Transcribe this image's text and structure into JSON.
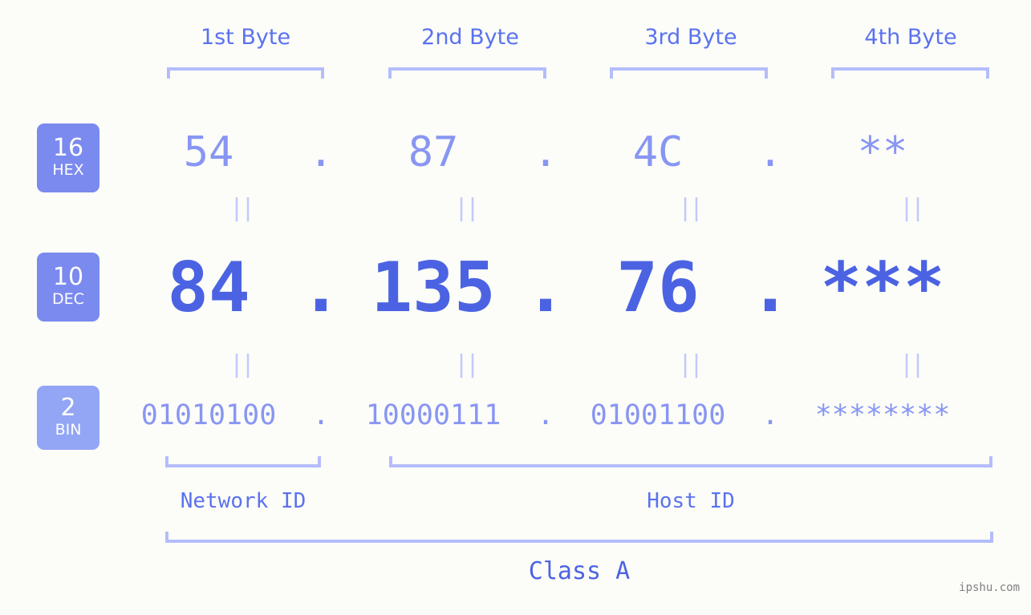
{
  "meta": {
    "background_color": "#fcfdf9",
    "accent_color": "#4b63e2",
    "accent_light_color": "#8896f2",
    "bracket_color": "#b4bdfb",
    "badge_color": "#7b8aef",
    "badge_bin_color": "#93a5f5",
    "watermark": "ipshu.com"
  },
  "byte_headers": [
    {
      "label": "1st Byte"
    },
    {
      "label": "2nd Byte"
    },
    {
      "label": "3rd Byte"
    },
    {
      "label": "4th Byte"
    }
  ],
  "radix_badges": [
    {
      "base": "16",
      "name": "HEX"
    },
    {
      "base": "10",
      "name": "DEC"
    },
    {
      "base": "2",
      "name": "BIN"
    }
  ],
  "rows": {
    "hex": {
      "values": [
        "54",
        "87",
        "4C",
        "**"
      ],
      "separator": "."
    },
    "dec": {
      "values": [
        "84",
        "135",
        "76",
        "***"
      ],
      "separator": "."
    },
    "bin": {
      "values": [
        "01010100",
        "10000111",
        "01001100",
        "********"
      ],
      "separator": "."
    }
  },
  "equality_marks": {
    "symbol": "||",
    "count_per_row": 4,
    "rows": 2
  },
  "id_sections": [
    {
      "label": "Network ID"
    },
    {
      "label": "Host ID"
    }
  ],
  "class_label": "Class A"
}
